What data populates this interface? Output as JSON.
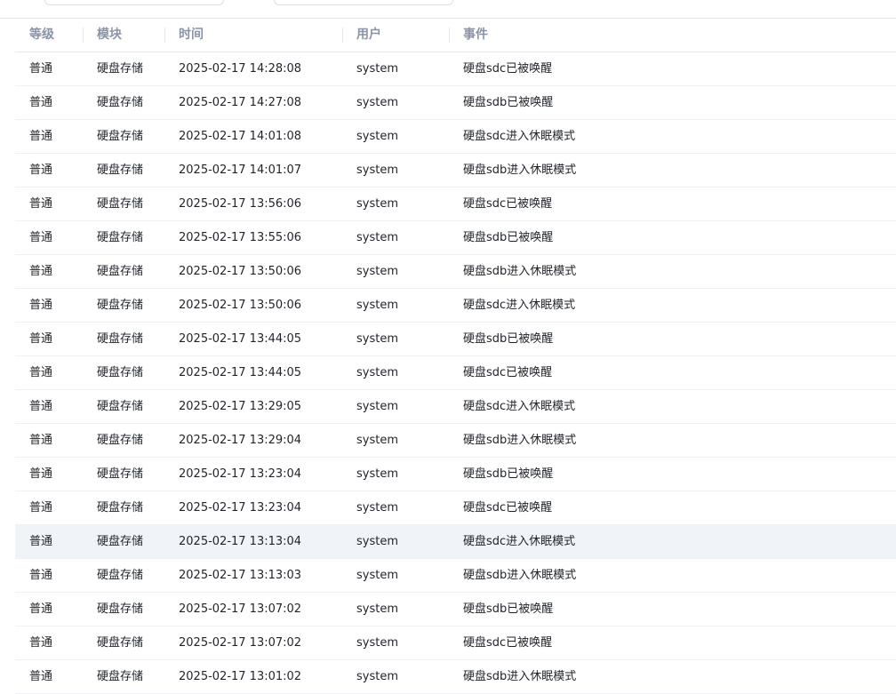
{
  "table": {
    "headers": {
      "level": "等级",
      "module": "模块",
      "time": "时间",
      "user": "用户",
      "event": "事件"
    },
    "rows": [
      {
        "level": "普通",
        "module": "硬盘存储",
        "time": "2025-02-17 14:28:08",
        "user": "system",
        "event": "硬盘sdc已被唤醒"
      },
      {
        "level": "普通",
        "module": "硬盘存储",
        "time": "2025-02-17 14:27:08",
        "user": "system",
        "event": "硬盘sdb已被唤醒"
      },
      {
        "level": "普通",
        "module": "硬盘存储",
        "time": "2025-02-17 14:01:08",
        "user": "system",
        "event": "硬盘sdc进入休眠模式"
      },
      {
        "level": "普通",
        "module": "硬盘存储",
        "time": "2025-02-17 14:01:07",
        "user": "system",
        "event": "硬盘sdb进入休眠模式"
      },
      {
        "level": "普通",
        "module": "硬盘存储",
        "time": "2025-02-17 13:56:06",
        "user": "system",
        "event": "硬盘sdc已被唤醒"
      },
      {
        "level": "普通",
        "module": "硬盘存储",
        "time": "2025-02-17 13:55:06",
        "user": "system",
        "event": "硬盘sdb已被唤醒"
      },
      {
        "level": "普通",
        "module": "硬盘存储",
        "time": "2025-02-17 13:50:06",
        "user": "system",
        "event": "硬盘sdb进入休眠模式"
      },
      {
        "level": "普通",
        "module": "硬盘存储",
        "time": "2025-02-17 13:50:06",
        "user": "system",
        "event": "硬盘sdc进入休眠模式"
      },
      {
        "level": "普通",
        "module": "硬盘存储",
        "time": "2025-02-17 13:44:05",
        "user": "system",
        "event": "硬盘sdb已被唤醒"
      },
      {
        "level": "普通",
        "module": "硬盘存储",
        "time": "2025-02-17 13:44:05",
        "user": "system",
        "event": "硬盘sdc已被唤醒"
      },
      {
        "level": "普通",
        "module": "硬盘存储",
        "time": "2025-02-17 13:29:05",
        "user": "system",
        "event": "硬盘sdc进入休眠模式"
      },
      {
        "level": "普通",
        "module": "硬盘存储",
        "time": "2025-02-17 13:29:04",
        "user": "system",
        "event": "硬盘sdb进入休眠模式"
      },
      {
        "level": "普通",
        "module": "硬盘存储",
        "time": "2025-02-17 13:23:04",
        "user": "system",
        "event": "硬盘sdb已被唤醒"
      },
      {
        "level": "普通",
        "module": "硬盘存储",
        "time": "2025-02-17 13:23:04",
        "user": "system",
        "event": "硬盘sdc已被唤醒"
      },
      {
        "level": "普通",
        "module": "硬盘存储",
        "time": "2025-02-17 13:13:04",
        "user": "system",
        "event": "硬盘sdc进入休眠模式"
      },
      {
        "level": "普通",
        "module": "硬盘存储",
        "time": "2025-02-17 13:13:03",
        "user": "system",
        "event": "硬盘sdb进入休眠模式"
      },
      {
        "level": "普通",
        "module": "硬盘存储",
        "time": "2025-02-17 13:07:02",
        "user": "system",
        "event": "硬盘sdb已被唤醒"
      },
      {
        "level": "普通",
        "module": "硬盘存储",
        "time": "2025-02-17 13:07:02",
        "user": "system",
        "event": "硬盘sdc已被唤醒"
      },
      {
        "level": "普通",
        "module": "硬盘存储",
        "time": "2025-02-17 13:01:02",
        "user": "system",
        "event": "硬盘sdb进入休眠模式"
      }
    ],
    "highlighted_row": 14
  },
  "colors": {
    "header_text": "#8a94a6",
    "row_highlight": "#f0f4f9",
    "border": "#e6e9ee"
  }
}
